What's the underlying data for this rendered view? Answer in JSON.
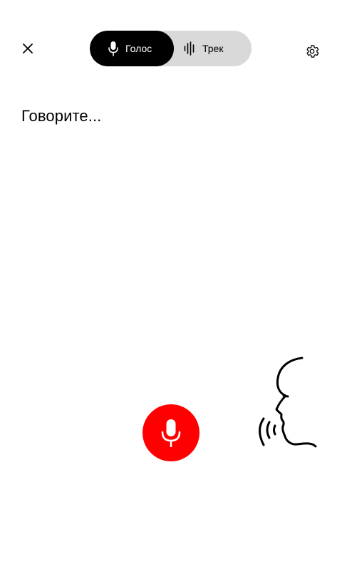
{
  "header": {
    "close_icon": "close-icon",
    "settings_icon": "gear-icon"
  },
  "mode_toggle": {
    "voice_label": "Голос",
    "voice_icon": "microphone-icon",
    "track_label": "Трек",
    "track_icon": "sound-wave-icon",
    "active": "voice"
  },
  "main": {
    "prompt": "Говорите..."
  },
  "mic_button": {
    "icon": "microphone-icon",
    "color": "#ff0000"
  },
  "illustration": {
    "icon": "speaking-head-icon"
  }
}
